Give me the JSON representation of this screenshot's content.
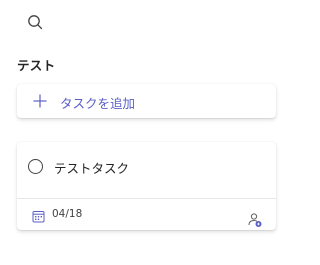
{
  "header": {
    "search_icon": "search-icon"
  },
  "section": {
    "title": "テスト"
  },
  "add_task": {
    "label": "タスクを追加",
    "icon": "plus-icon"
  },
  "tasks": [
    {
      "title": "テストタスク",
      "due_date": "04/18",
      "date_icon": "calendar-icon",
      "assign_icon": "assign-user-icon",
      "completed": false
    }
  ],
  "colors": {
    "accent": "#5b5fc7",
    "text": "#242424",
    "divider": "#e6e6e6"
  }
}
